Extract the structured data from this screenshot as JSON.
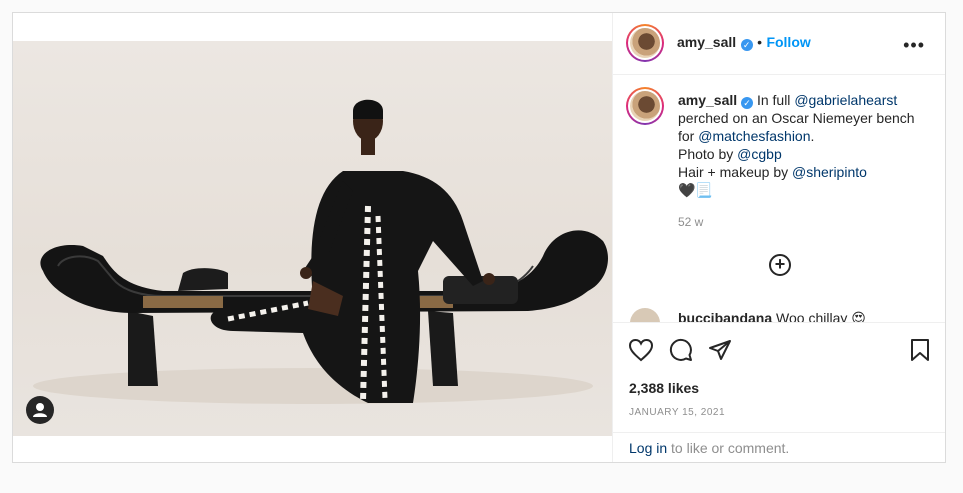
{
  "header": {
    "username": "amy_sall",
    "separator": "•",
    "follow_label": "Follow",
    "more_glyph": "•••"
  },
  "caption": {
    "username": "amy_sall",
    "text_1": "In full ",
    "mention_1": "@gabrielahearst",
    "text_2": " perched on an Oscar Niemeyer bench for ",
    "mention_2": "@matchesfashion",
    "text_3": ".",
    "line_photo": "Photo by ",
    "mention_3": "@cgbp",
    "line_hair": "Hair + makeup by ",
    "mention_4": "@sheripinto",
    "emoji": "🖤📃",
    "time": "52 w"
  },
  "comment_preview": {
    "username": "buccibandana",
    "text": "Woo chillay 😍"
  },
  "actions": {
    "icons": [
      "heart-icon",
      "comment-icon",
      "share-icon",
      "bookmark-icon"
    ],
    "likes": "2,388 likes",
    "date": "JANUARY 15, 2021"
  },
  "login": {
    "link": "Log in",
    "text": " to like or comment."
  }
}
